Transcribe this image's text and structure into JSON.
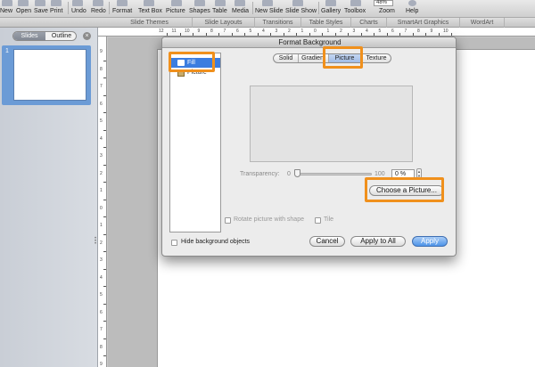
{
  "toolbar": {
    "items": [
      "New",
      "Open",
      "Save",
      "Print",
      "Undo",
      "Redo",
      "Format",
      "Text Box",
      "Picture",
      "Shapes",
      "Table",
      "Media",
      "New Slide",
      "Slide Show",
      "Gallery",
      "Toolbox",
      "Zoom",
      "Help"
    ],
    "zoom_value": "48%"
  },
  "ribbon": {
    "tabs": [
      "Slide Themes",
      "Slide Layouts",
      "Transitions",
      "Table Styles",
      "Charts",
      "SmartArt Graphics",
      "WordArt"
    ]
  },
  "sidebar": {
    "view_tabs": [
      "Slides",
      "Outline"
    ],
    "slide_number": "1"
  },
  "rulers": {
    "top": [
      "12",
      "11",
      "10",
      "9",
      "8",
      "7",
      "6",
      "5",
      "4",
      "3",
      "2",
      "1",
      "0",
      "1",
      "2",
      "3",
      "4",
      "5",
      "6",
      "7",
      "8",
      "9",
      "10"
    ],
    "left": [
      "9",
      "8",
      "7",
      "6",
      "5",
      "4",
      "3",
      "2",
      "1",
      "0",
      "1",
      "2",
      "3",
      "4",
      "5",
      "6",
      "7",
      "8",
      "9"
    ]
  },
  "dialog": {
    "title": "Format Background",
    "categories": [
      "Fill",
      "Picture"
    ],
    "fill_tabs": [
      "Solid",
      "Gradient",
      "Picture",
      "Texture"
    ],
    "active_tab": "Picture",
    "transparency_label": "Transparency:",
    "transparency_min": "0",
    "transparency_max": "100",
    "transparency_value": "0 %",
    "transparency_level": 0,
    "choose_picture_label": "Choose a Picture...",
    "rotate_label": "Rotate picture with shape",
    "tile_label": "Tile",
    "hide_bg_label": "Hide background objects",
    "cancel_label": "Cancel",
    "apply_all_label": "Apply to All",
    "apply_label": "Apply"
  },
  "colors": {
    "highlight": "#f0901c",
    "selection": "#3b7de0",
    "primary_button": "#4d93e8"
  }
}
